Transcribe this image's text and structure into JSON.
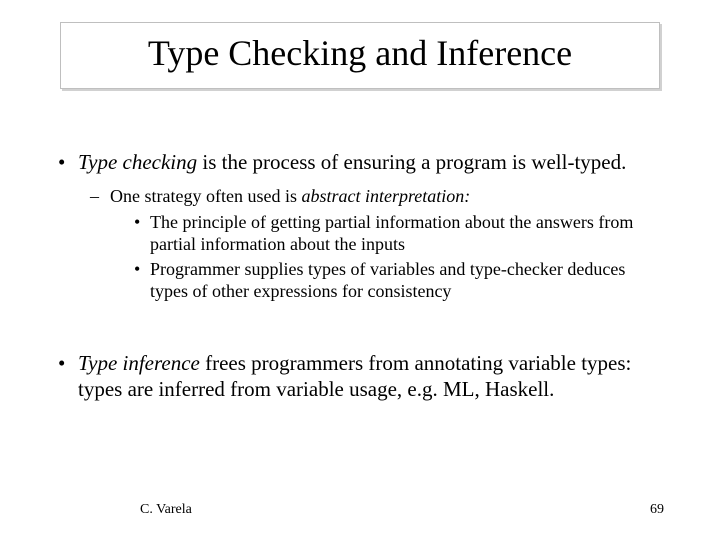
{
  "title": "Type Checking and Inference",
  "bullets": {
    "b1_pre": "Type checking",
    "b1_post": " is the process of ensuring a program is well-typed.",
    "b1_sub_pre": "One strategy often used is ",
    "b1_sub_em": "abstract interpretation:",
    "b1_sub_sub1": "The principle of getting partial information about the answers from partial information about the inputs",
    "b1_sub_sub2": "Programmer supplies types of variables and type-checker deduces types of other expressions for consistency",
    "b2_pre": "Type inference",
    "b2_post": " frees programmers from annotating variable types: types are inferred from variable usage, e.g. ML, Haskell."
  },
  "footer": {
    "author": "C. Varela",
    "page": "69"
  }
}
